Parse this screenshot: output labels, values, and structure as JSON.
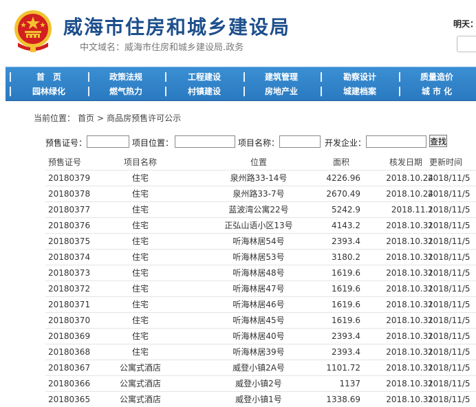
{
  "header": {
    "title": "威海市住房和城乡建设局",
    "subtitle": "中文域名：威海市住房和城乡建设局.政务",
    "date_label": "明天："
  },
  "nav": {
    "row1": [
      "首　页",
      "政策法规",
      "工程建设",
      "建筑管理",
      "勘察设计",
      "质量造价"
    ],
    "row2": [
      "园林绿化",
      "燃气热力",
      "村镇建设",
      "房地产业",
      "城建档案",
      "城 市 化"
    ]
  },
  "breadcrumb": {
    "prefix": "当前位置：",
    "home": "首页",
    "separator": ">",
    "current": "商品房预售许可公示"
  },
  "search": {
    "fields": [
      "预售证号：",
      "项目位置：",
      "项目名称：",
      "开发企业："
    ],
    "button": "查找"
  },
  "table": {
    "headers": [
      "预售证号",
      "项目名称",
      "位置",
      "面积",
      "核发日期",
      "更新时间"
    ],
    "rows": [
      [
        "20180379",
        "住宅",
        "泉州路33-14号",
        "4226.96",
        "2018.10.24",
        "2018/11/5"
      ],
      [
        "20180378",
        "住宅",
        "泉州路33-7号",
        "2670.49",
        "2018.10.24",
        "2018/11/5"
      ],
      [
        "20180377",
        "住宅",
        "蓝波湾公寓22号",
        "5242.9",
        "2018.11.1",
        "2018/11/5"
      ],
      [
        "20180376",
        "住宅",
        "正弘山语小区13号",
        "4143.2",
        "2018.10.31",
        "2018/11/5"
      ],
      [
        "20180375",
        "住宅",
        "听海林居54号",
        "2393.4",
        "2018.10.31",
        "2018/11/5"
      ],
      [
        "20180374",
        "住宅",
        "听海林居53号",
        "3180.2",
        "2018.10.31",
        "2018/11/5"
      ],
      [
        "20180373",
        "住宅",
        "听海林居48号",
        "1619.6",
        "2018.10.31",
        "2018/11/5"
      ],
      [
        "20180372",
        "住宅",
        "听海林居47号",
        "1619.6",
        "2018.10.31",
        "2018/11/5"
      ],
      [
        "20180371",
        "住宅",
        "听海林居46号",
        "1619.6",
        "2018.10.31",
        "2018/11/5"
      ],
      [
        "20180370",
        "住宅",
        "听海林居45号",
        "1619.6",
        "2018.10.31",
        "2018/11/5"
      ],
      [
        "20180369",
        "住宅",
        "听海林居40号",
        "2393.4",
        "2018.10.31",
        "2018/11/5"
      ],
      [
        "20180368",
        "住宅",
        "听海林居39号",
        "2393.4",
        "2018.10.31",
        "2018/11/5"
      ],
      [
        "20180367",
        "公寓式酒店",
        "威登小镇2A号",
        "1101.72",
        "2018.10.31",
        "2018/11/5"
      ],
      [
        "20180366",
        "公寓式酒店",
        "威登小镇2号",
        "1137",
        "2018.10.31",
        "2018/11/5"
      ],
      [
        "20180365",
        "公寓式酒店",
        "威登小镇1号",
        "1338.69",
        "2018.10.31",
        "2018/11/5"
      ]
    ]
  },
  "colors": {
    "title": "#1d4f8c",
    "nav_bg": "#2a79c0",
    "emblem_red": "#d21f1f",
    "emblem_gold": "#f2c230"
  }
}
